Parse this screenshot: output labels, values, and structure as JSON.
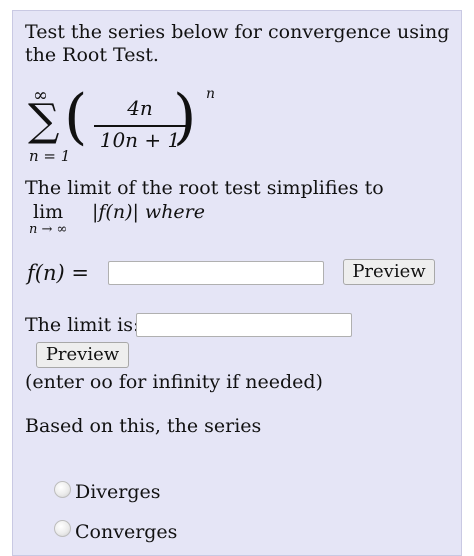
{
  "question": {
    "prompt": "Test the series below for convergence using the Root Test.",
    "series": {
      "sum_symbol": "∑",
      "upper_limit": "∞",
      "lower_limit": "n = 1",
      "left_paren": "(",
      "right_paren": ")",
      "numerator": "4n",
      "denominator": "10n + 1",
      "exponent": "n"
    },
    "root_test_text": "The limit of the root test simplifies to",
    "lim_word": "lim",
    "lim_subscript": "n → ∞",
    "lim_expression": "|f(n)| where"
  },
  "fn_field": {
    "label": "f(n) =",
    "value": "",
    "preview_label": "Preview"
  },
  "limit_field": {
    "label": "The limit is:",
    "value": "",
    "preview_label": "Preview",
    "hint": "(enter oo for infinity if needed)"
  },
  "conclusion": {
    "text": "Based on this, the series",
    "options": [
      {
        "label": "Diverges",
        "selected": false
      },
      {
        "label": "Converges",
        "selected": false
      }
    ]
  },
  "colors": {
    "panel_background": "#e5e5f6",
    "button_background": "#eeeeee"
  }
}
